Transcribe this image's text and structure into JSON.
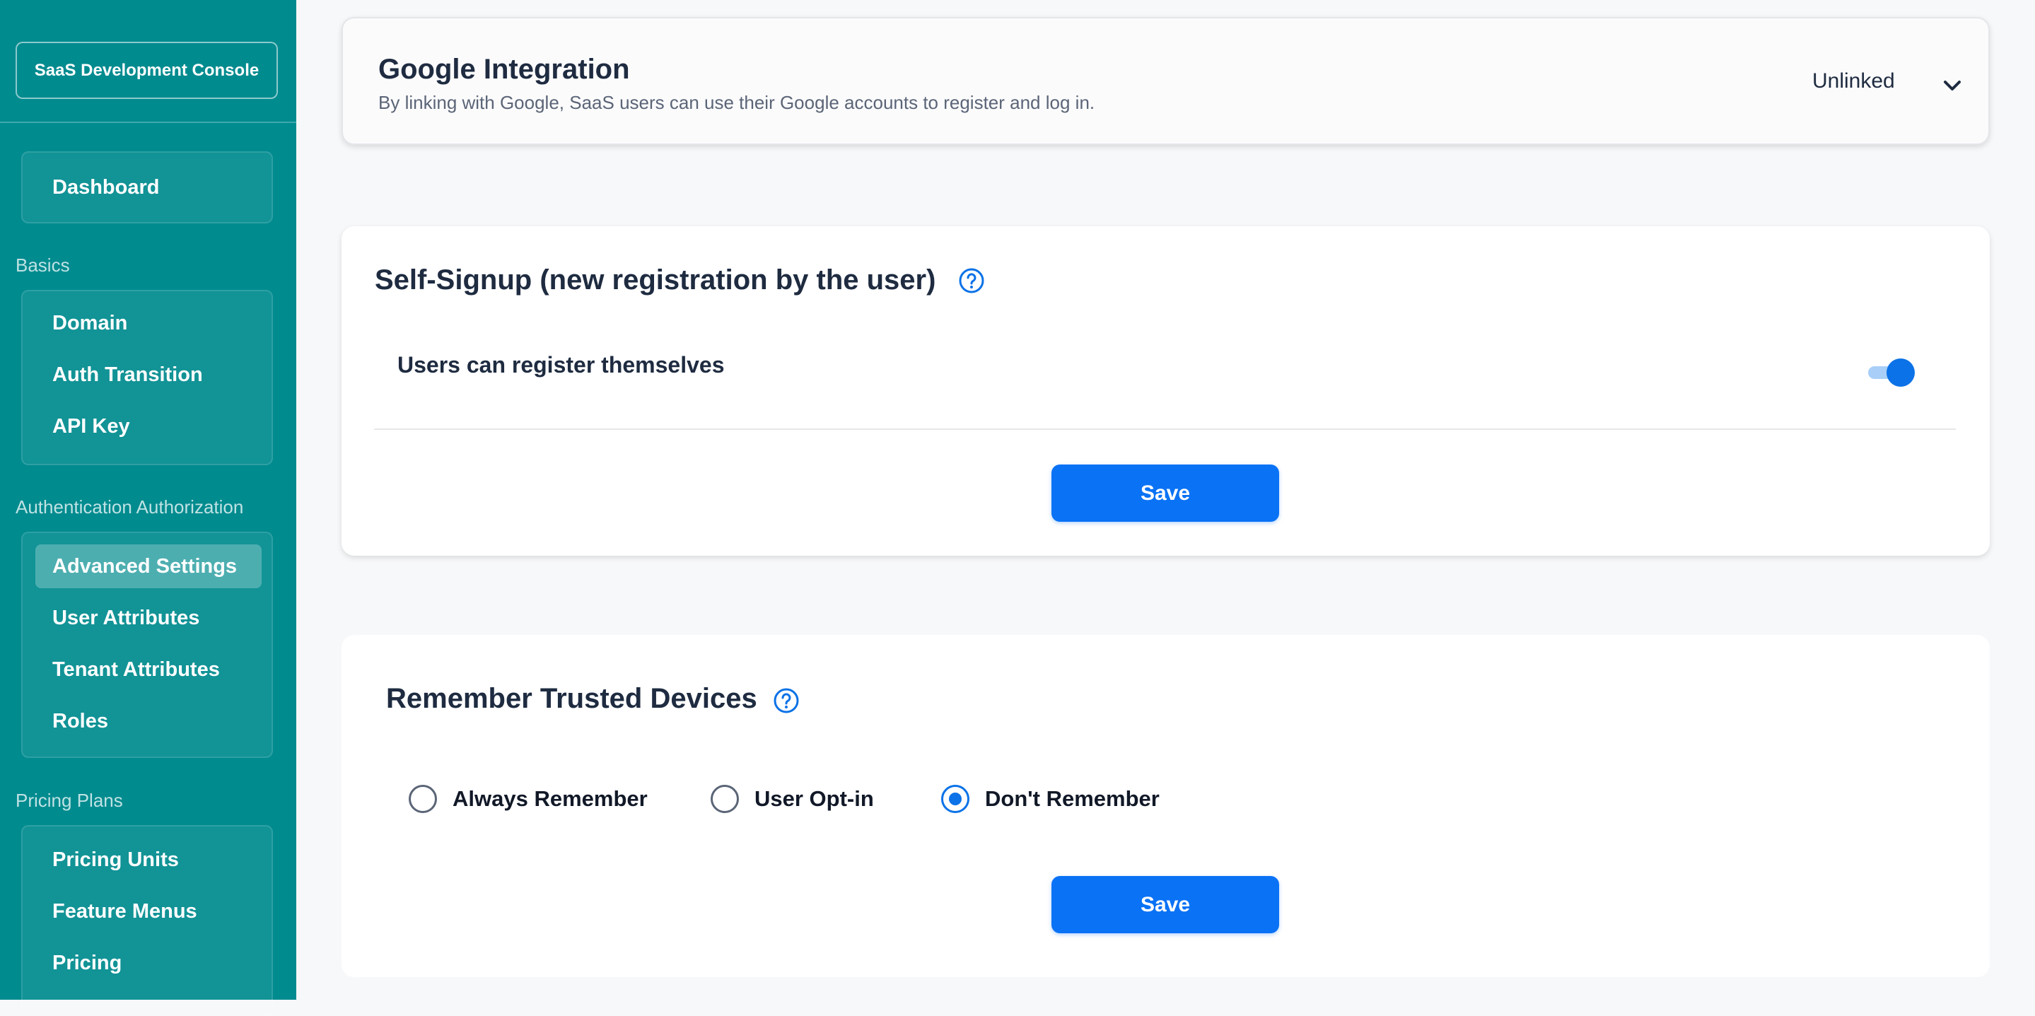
{
  "sidebar": {
    "console_label": "SaaS Development Console",
    "dashboard": "Dashboard",
    "basics": {
      "label": "Basics",
      "items": [
        "Domain",
        "Auth Transition",
        "API Key"
      ]
    },
    "auth": {
      "label": "Authentication Authorization",
      "items": [
        "Advanced Settings",
        "User Attributes",
        "Tenant Attributes",
        "Roles"
      ],
      "active": "Advanced Settings"
    },
    "pricing": {
      "label": "Pricing Plans",
      "items": [
        "Pricing Units",
        "Feature Menus",
        "Pricing"
      ]
    }
  },
  "google": {
    "title": "Google Integration",
    "description": "By linking with Google, SaaS users can use their Google accounts to register and log in.",
    "status": "Unlinked",
    "chevron_icon": "chevron-down-icon"
  },
  "self_signup": {
    "title": "Self-Signup (new registration by the user)",
    "help_icon": "question-circle-icon",
    "row_label": "Users can register themselves",
    "toggle_on": true,
    "save_label": "Save"
  },
  "trusted_devices": {
    "title": "Remember Trusted Devices",
    "help_icon": "question-circle-icon",
    "options": [
      "Always Remember",
      "User Opt-in",
      "Don't Remember"
    ],
    "selected": "Don't Remember",
    "save_label": "Save"
  },
  "colors": {
    "sidebar": "#008b8f",
    "primary": "#0a72f5",
    "text_dark": "#1e2b40"
  }
}
